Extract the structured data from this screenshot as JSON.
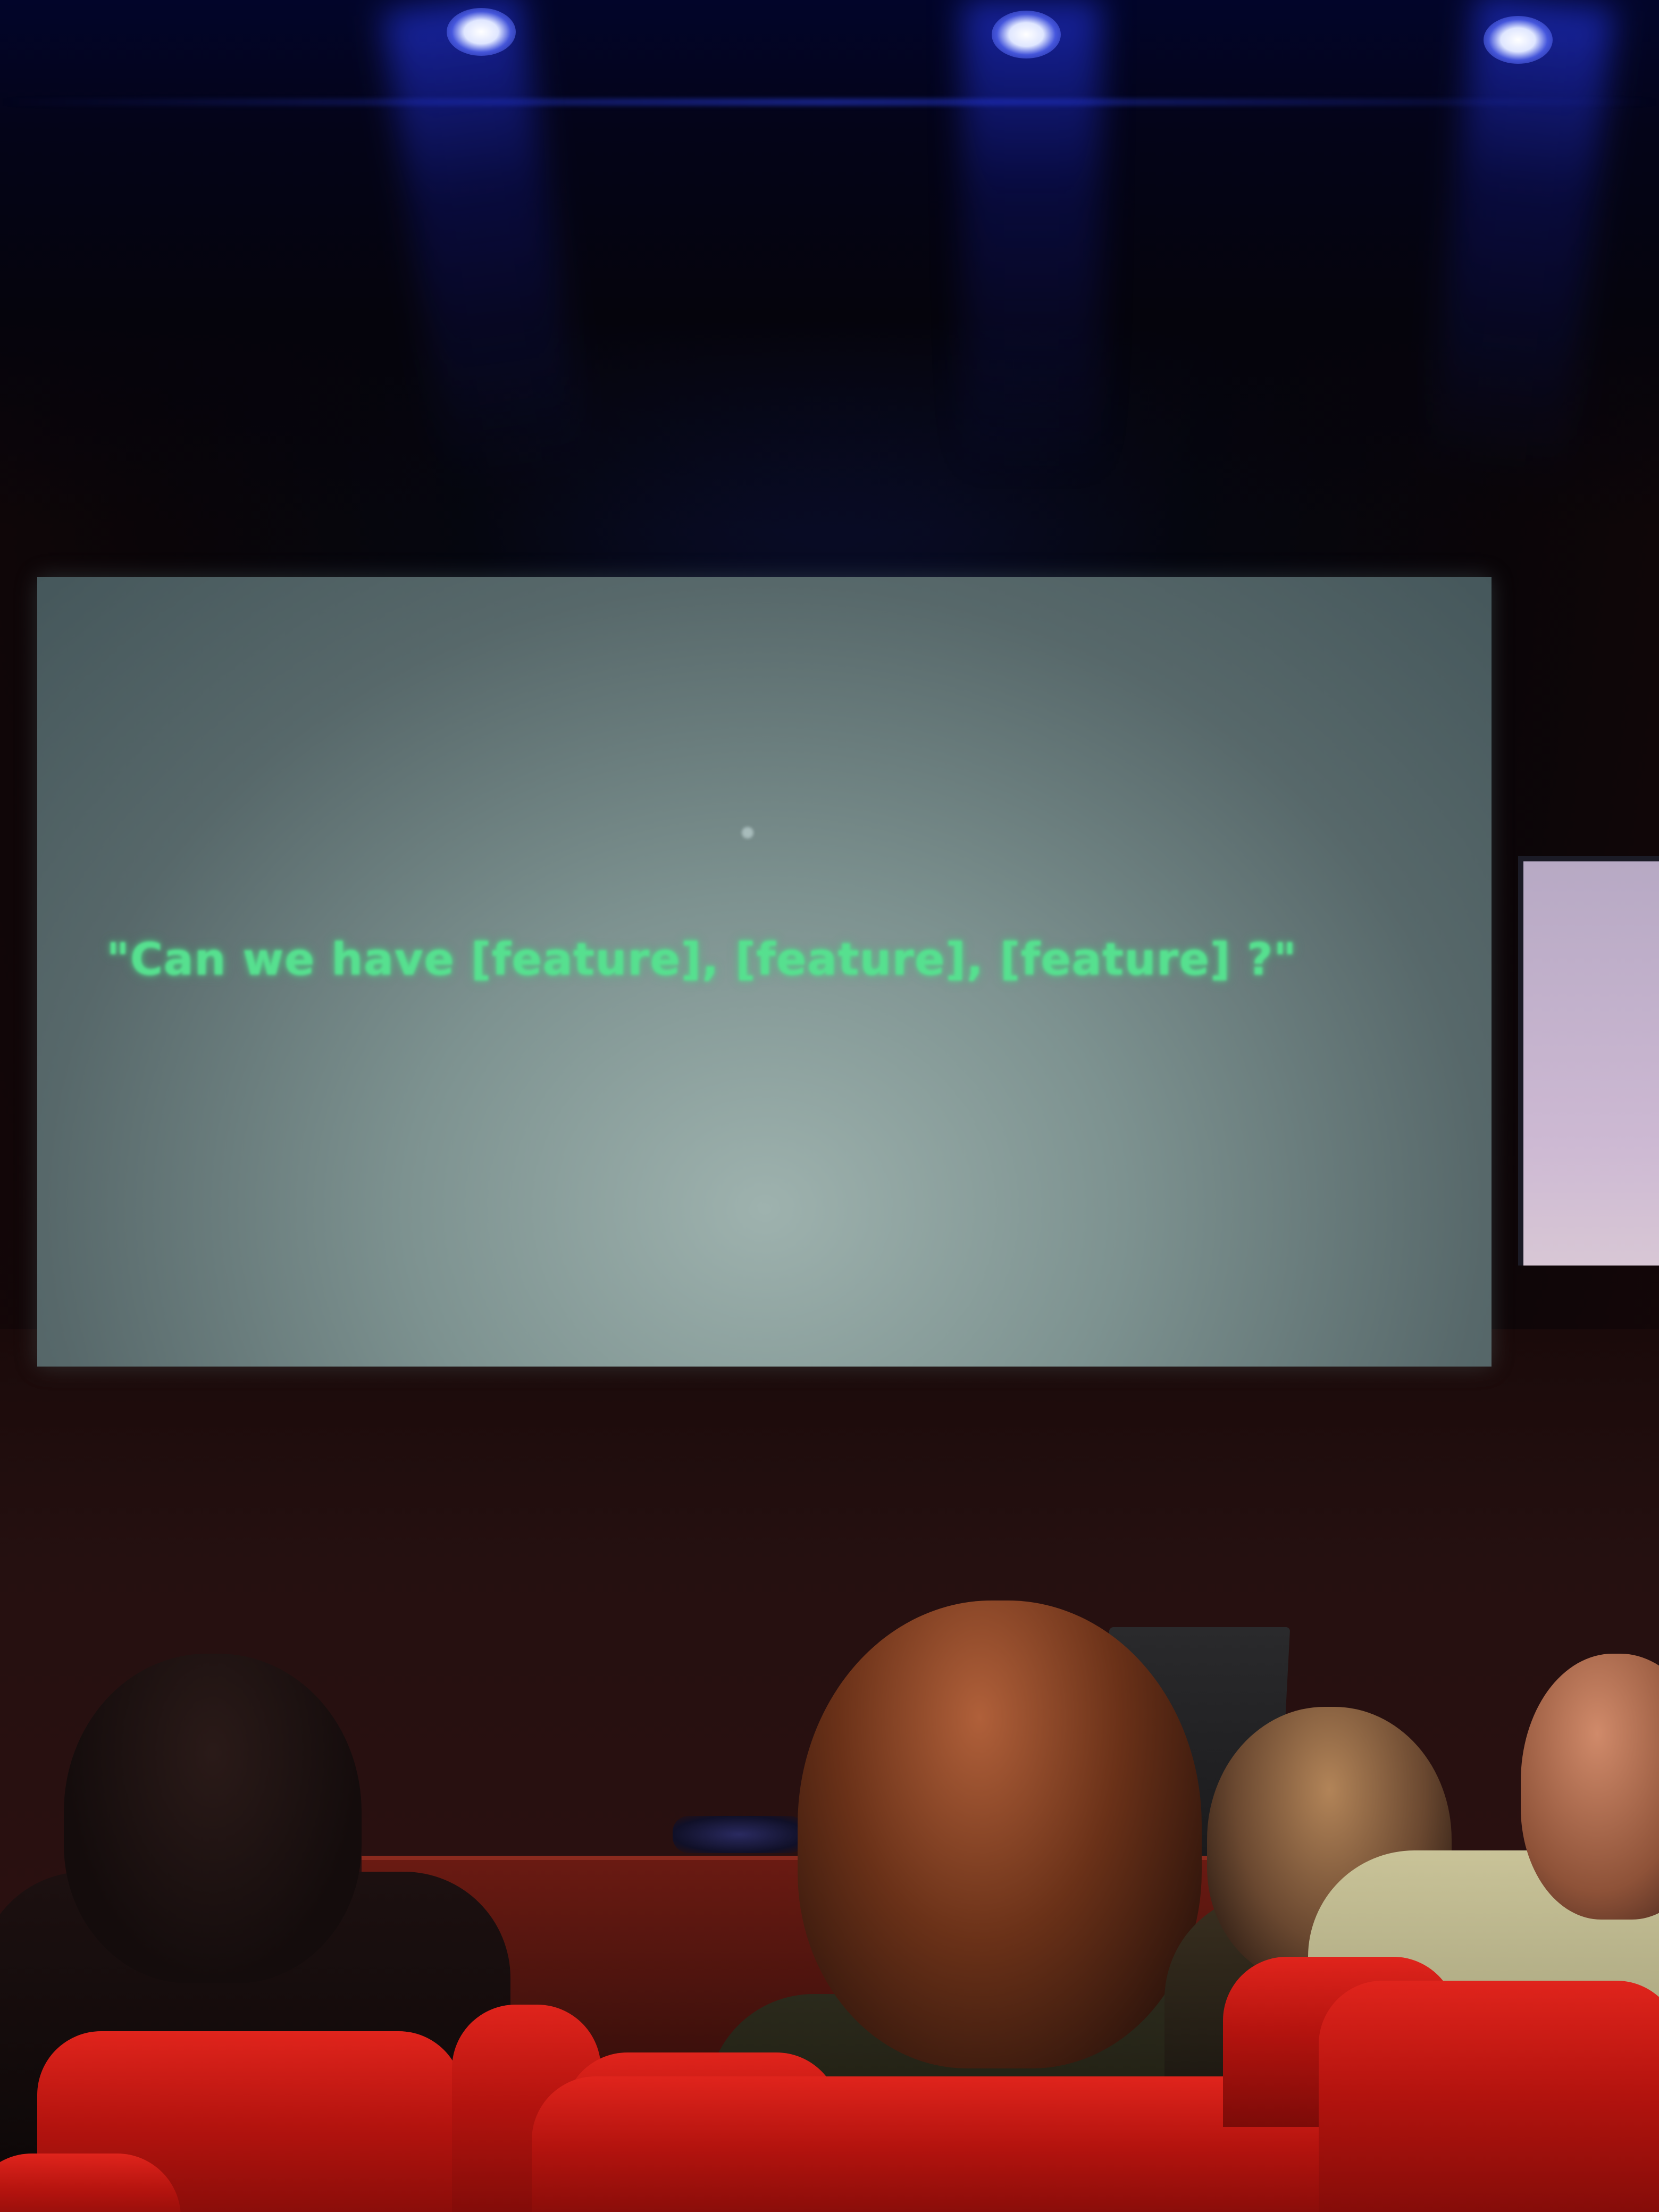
{
  "scene": {
    "description_kind": "photo",
    "colors": {
      "stage_light": "#3a50ff",
      "slide_background": "#7d9290",
      "slide_text": "#56e08f",
      "seat_red": "#d01a14",
      "wall": "#2a1010"
    }
  },
  "slide": {
    "text": "\"Can we have [feature], [feature], [feature] ?\""
  }
}
